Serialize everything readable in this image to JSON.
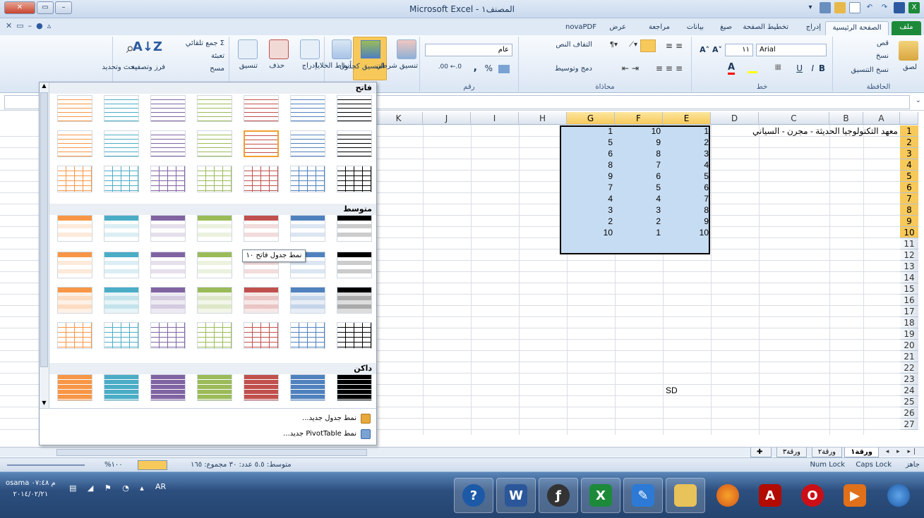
{
  "window": {
    "title": "Microsoft Excel - المصنف١",
    "min_label": "–",
    "max_label": "▭",
    "close_label": "✕"
  },
  "tabs": [
    "ملف",
    "الصفحة الرئيسية",
    "إدراج",
    "تخطيط الصفحة",
    "صيغ",
    "بيانات",
    "مراجعة",
    "عرض",
    "novaPDF"
  ],
  "ribbon": {
    "clipboard": {
      "paste": "لصق",
      "cut": "قص",
      "copy": "نسخ",
      "format_painter": "نسخ التنسيق",
      "label": "الحافظة"
    },
    "font": {
      "name": "Arial",
      "size": "١١",
      "label": "خط",
      "bold": "B",
      "italic": "I",
      "underline": "U"
    },
    "alignment": {
      "wrap": "التفاف النص",
      "merge": "دمج وتوسيط",
      "label": "محاذاة"
    },
    "number": {
      "format": "عام",
      "label": "رقم",
      "percent": "%",
      "comma": ","
    },
    "styles": {
      "conditional": "تنسيق شرطي",
      "as_table": "التنسيق كجدول",
      "cell_styles": "أنماط الخلايا"
    },
    "cells": {
      "insert": "إدراج",
      "delete": "حذف",
      "format": "تنسيق"
    },
    "editing": {
      "autosum": "جمع تلقائي",
      "fill": "تعبئة",
      "clear": "مسح",
      "sort": "فرز وتصفية",
      "find": "بحث وتحديد"
    }
  },
  "gallery": {
    "sections": [
      "فاتح",
      "متوسط",
      "داكن"
    ],
    "tooltip": "نمط جدول فاتح ١٠",
    "new_table_style": "نمط جدول جديد...",
    "new_pivot_style": "نمط PivotTable جديد...",
    "swatch_colors": [
      "#000000",
      "#4f81bd",
      "#c0504d",
      "#9bbb59",
      "#8064a2",
      "#4bacc6",
      "#f79646"
    ]
  },
  "grid": {
    "columns": [
      "A",
      "B",
      "C",
      "D",
      "E",
      "F",
      "G",
      "H",
      "I",
      "J",
      "K"
    ],
    "rows": [
      "1",
      "2",
      "3",
      "4",
      "5",
      "6",
      "7",
      "8",
      "9",
      "10",
      "11",
      "12",
      "13",
      "14",
      "15",
      "16",
      "17",
      "18",
      "19",
      "20",
      "21",
      "22",
      "23",
      "24",
      "25",
      "26",
      "27"
    ],
    "a1_text": "معهد التكنولوجيا الحديثة - مجرن - السياني",
    "col_e": [
      "1",
      "2",
      "3",
      "4",
      "5",
      "6",
      "7",
      "8",
      "9",
      "10"
    ],
    "col_f": [
      "10",
      "9",
      "8",
      "7",
      "6",
      "5",
      "4",
      "3",
      "2",
      "1"
    ],
    "col_g": [
      "1",
      "5",
      "6",
      "8",
      "9",
      "7",
      "4",
      "3",
      "2",
      "10"
    ],
    "e24_text": "SD"
  },
  "sheets": [
    "ورقة١",
    "ورقة٢",
    "ورقة٣"
  ],
  "status": {
    "ready": "جاهز",
    "caps": "Caps Lock",
    "num": "Num Lock",
    "summary": "متوسط: ٥.٥   عدد: ٣٠   مجموع: ١٦٥",
    "zoom": "%١٠٠"
  },
  "taskbar": {
    "user": "osama م ٠٧:٤٨",
    "date": "٢٠١٤/٠٢/٢١",
    "lang": "AR"
  }
}
